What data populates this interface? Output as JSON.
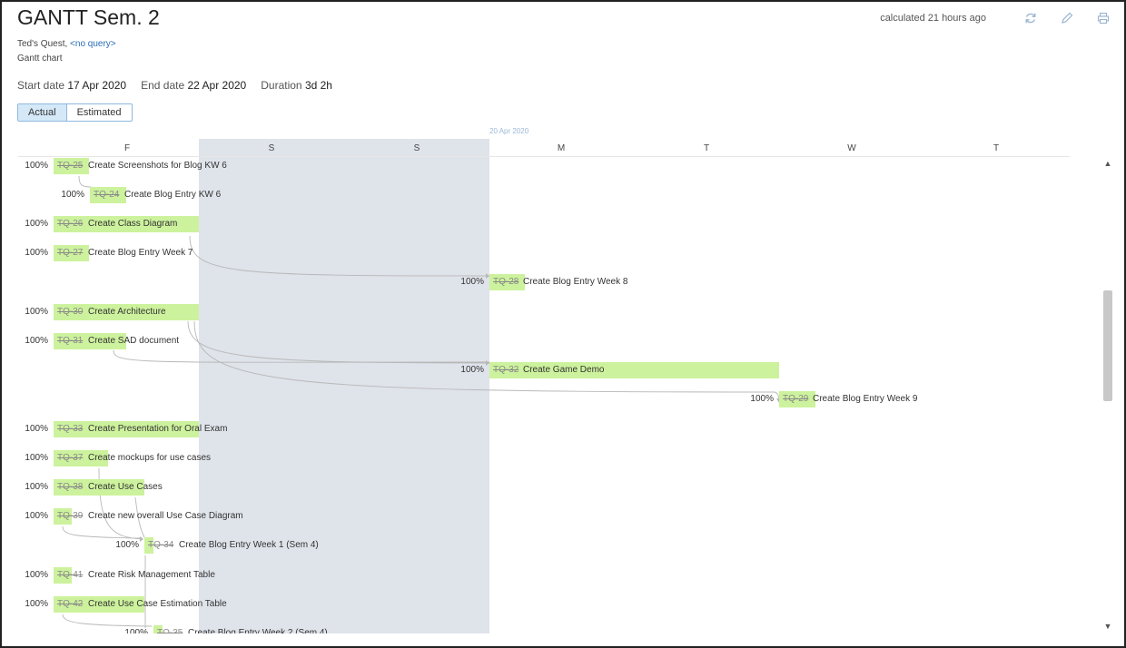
{
  "header": {
    "title": "GANTT Sem. 2",
    "subtitle_prefix": "Ted's Quest, ",
    "subtitle_link": "<no query>",
    "kind": "Gantt chart",
    "calculated": "calculated 21 hours ago",
    "icons": [
      "refresh-icon",
      "edit-icon",
      "print-icon"
    ]
  },
  "dates": {
    "start_label": "Start date",
    "start_value": "17 Apr 2020",
    "end_label": "End date",
    "end_value": "22 Apr 2020",
    "duration_label": "Duration",
    "duration_value": "3d 2h"
  },
  "toggle": {
    "actual": "Actual",
    "estimated": "Estimated",
    "selected": "Actual"
  },
  "timeline": {
    "week_label": "20 Apr 2020",
    "days": [
      "F",
      "S",
      "S",
      "M",
      "T",
      "W",
      "T"
    ]
  },
  "tasks": [
    {
      "key": "TQ-25",
      "name": "Create Screenshots for Blog KW 6",
      "pct": "100%"
    },
    {
      "key": "TQ-24",
      "name": "Create Blog Entry KW 6",
      "pct": "100%"
    },
    {
      "key": "TQ-26",
      "name": "Create Class Diagram",
      "pct": "100%"
    },
    {
      "key": "TQ-27",
      "name": "Create Blog Entry Week 7",
      "pct": "100%"
    },
    {
      "key": "TQ-28",
      "name": "Create Blog Entry Week 8",
      "pct": "100%"
    },
    {
      "key": "TQ-30",
      "name": "Create Architecture",
      "pct": "100%"
    },
    {
      "key": "TQ-31",
      "name": "Create SAD document",
      "pct": "100%"
    },
    {
      "key": "TQ-32",
      "name": "Create Game Demo",
      "pct": "100%"
    },
    {
      "key": "TQ-29",
      "name": "Create Blog Entry Week 9",
      "pct": "100%"
    },
    {
      "key": "TQ-33",
      "name": "Create Presentation for Oral Exam",
      "pct": "100%"
    },
    {
      "key": "TQ-37",
      "name": "Create mockups for use cases",
      "pct": "100%"
    },
    {
      "key": "TQ-38",
      "name": "Create Use Cases",
      "pct": "100%"
    },
    {
      "key": "TQ-39",
      "name": "Create new overall Use Case Diagram",
      "pct": "100%"
    },
    {
      "key": "TQ-34",
      "name": "Create Blog Entry Week 1 (Sem 4)",
      "pct": "100%"
    },
    {
      "key": "TQ-41",
      "name": "Create Risk Management Table",
      "pct": "100%"
    },
    {
      "key": "TQ-42",
      "name": "Create Use Case Estimation Table",
      "pct": "100%"
    },
    {
      "key": "TQ-35",
      "name": "Create Blog Entry Week 2 (Sem 4)",
      "pct": "100%"
    }
  ]
}
